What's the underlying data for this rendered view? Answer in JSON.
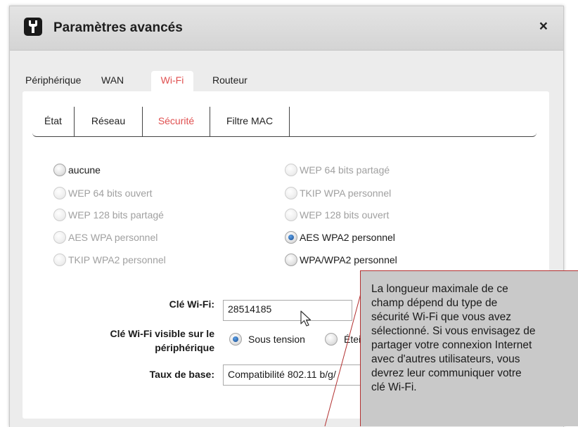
{
  "dialog": {
    "title": "Paramètres avancés",
    "close_label": "×"
  },
  "tabs": [
    {
      "label": "Périphérique",
      "active": false
    },
    {
      "label": "WAN",
      "active": false
    },
    {
      "label": "Wi-Fi",
      "active": true
    },
    {
      "label": "Routeur",
      "active": false
    }
  ],
  "subtabs": [
    {
      "label": "État",
      "active": false
    },
    {
      "label": "Réseau",
      "active": false
    },
    {
      "label": "Sécurité",
      "active": true
    },
    {
      "label": "Filtre MAC",
      "active": false
    }
  ],
  "security_options": {
    "left": [
      {
        "label": "aucune",
        "enabled": true,
        "checked": false
      },
      {
        "label": "WEP 64 bits ouvert",
        "enabled": false,
        "checked": false
      },
      {
        "label": "WEP 128 bits partagé",
        "enabled": false,
        "checked": false
      },
      {
        "label": "AES WPA personnel",
        "enabled": false,
        "checked": false
      },
      {
        "label": "TKIP WPA2 personnel",
        "enabled": false,
        "checked": false
      }
    ],
    "right": [
      {
        "label": "WEP 64 bits partagé",
        "enabled": false,
        "checked": false
      },
      {
        "label": "TKIP WPA personnel",
        "enabled": false,
        "checked": false
      },
      {
        "label": "WEP 128 bits ouvert",
        "enabled": false,
        "checked": false
      },
      {
        "label": "AES WPA2 personnel",
        "enabled": true,
        "checked": true
      },
      {
        "label": "WPA/WPA2 personnel",
        "enabled": true,
        "checked": false
      }
    ]
  },
  "form": {
    "key_label": "Clé Wi-Fi:",
    "key_value": "28514185",
    "visible_label_line1": "Clé Wi-Fi visible sur le",
    "visible_label_line2": "périphérique",
    "visible_on_label": "Sous tension",
    "visible_off_label": "Étei",
    "visible_selected": "on",
    "rate_label": "Taux de base:",
    "rate_value": "Compatibilité 802.11 b/g/"
  },
  "tooltip": {
    "lines": [
      "La longueur maximale de ce",
      "champ dépend du type de",
      "sécurité Wi-Fi que vous avez",
      "sélectionné. Si vous envisagez de",
      "partager votre connexion Internet",
      "avec d'autres utilisateurs, vous",
      "devrez leur communiquer votre",
      "clé Wi-Fi."
    ]
  },
  "colors": {
    "accent": "#e05050",
    "tooltip_bg": "#c9c9c9",
    "leader_line": "#b23030"
  }
}
